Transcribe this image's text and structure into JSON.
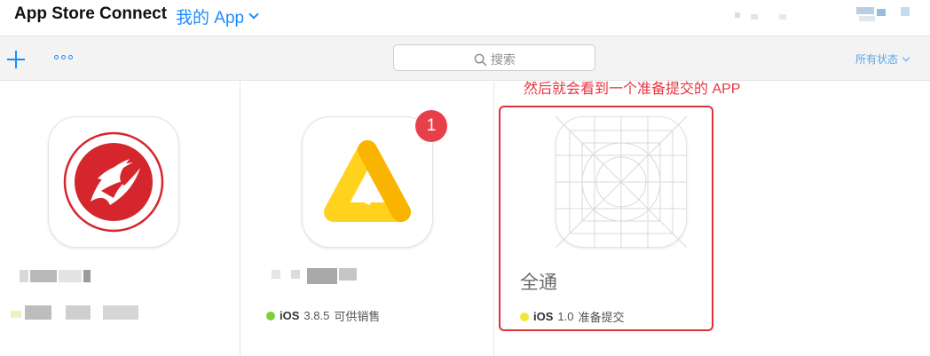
{
  "header": {
    "brand": "App Store Connect",
    "app_menu_label": "我的 App"
  },
  "toolbar": {
    "add_icon": "plus-icon",
    "more_icon": "ellipsis-icon",
    "search_placeholder": "搜索",
    "status_filter_label": "所有状态",
    "accent_color": "#1a8cff"
  },
  "apps": [
    {
      "name": "",
      "icon": "college-logo",
      "status_text": ""
    },
    {
      "name": "",
      "icon": "yellow-triangle",
      "badge": "1",
      "platform": "iOS",
      "version": "3.8.5",
      "status_label": "可供销售",
      "status_color": "#7ad13a"
    },
    {
      "name": "全通",
      "icon": "placeholder-grid-icon",
      "platform": "iOS",
      "version": "1.0",
      "status_label": "准备提交",
      "status_color": "#f2e83a"
    }
  ],
  "annotation": {
    "text": "然后就会看到一个准备提交的 APP",
    "color": "#e8343f"
  }
}
